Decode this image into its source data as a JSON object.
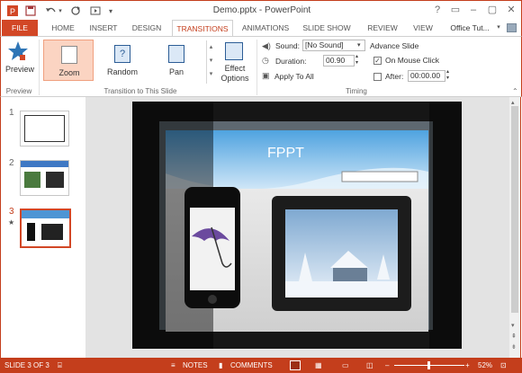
{
  "window": {
    "title": "Demo.pptx - PowerPoint"
  },
  "tabs": [
    {
      "label": "FILE"
    },
    {
      "label": "HOME"
    },
    {
      "label": "INSERT"
    },
    {
      "label": "DESIGN"
    },
    {
      "label": "TRANSITIONS"
    },
    {
      "label": "ANIMATIONS"
    },
    {
      "label": "SLIDE SHOW"
    },
    {
      "label": "REVIEW"
    },
    {
      "label": "VIEW"
    }
  ],
  "account": "Office Tut...",
  "ribbon": {
    "preview_label": "Preview",
    "preview_group": "Preview",
    "gallery": [
      {
        "label": "Zoom"
      },
      {
        "label": "Random"
      },
      {
        "label": "Pan"
      }
    ],
    "effect_options": "Effect Options",
    "transition_group": "Transition to This Slide",
    "sound_label": "Sound:",
    "sound_value": "[No Sound]",
    "duration_label": "Duration:",
    "duration_value": "00.90",
    "apply_all": "Apply To All",
    "advance_title": "Advance Slide",
    "on_mouse_click": "On Mouse Click",
    "after_label": "After:",
    "after_value": "00:00.00",
    "timing_group": "Timing"
  },
  "slides": [
    {
      "num": "1"
    },
    {
      "num": "2"
    },
    {
      "num": "3"
    }
  ],
  "slide_text": {
    "fppt": "FPPT"
  },
  "status": {
    "slide_of": "SLIDE 3 OF 3",
    "notes": "NOTES",
    "comments": "COMMENTS",
    "zoom": "52%"
  },
  "colors": {
    "accent": "#c43e1c",
    "file_tab": "#d24726",
    "selected_border": "#d24726"
  }
}
